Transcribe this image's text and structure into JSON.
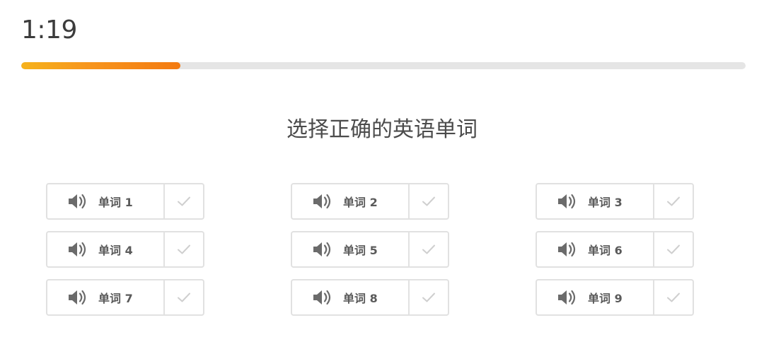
{
  "timer": {
    "text": "1:19"
  },
  "progress": {
    "fraction": 0.22
  },
  "prompt": {
    "text": "选择正确的英语单词"
  },
  "icons": {
    "speaker": "speaker-icon",
    "check": "check-icon"
  },
  "colors": {
    "progress_start": "#f6b21c",
    "progress_end": "#f37a10",
    "track": "#e5e5e5",
    "border": "#e1e1e1",
    "icon": "#6b6b6b",
    "check": "#cfcfcf"
  },
  "words": [
    {
      "label": "单词 1"
    },
    {
      "label": "单词 2"
    },
    {
      "label": "单词 3"
    },
    {
      "label": "单词 4"
    },
    {
      "label": "单词 5"
    },
    {
      "label": "单词 6"
    },
    {
      "label": "单词 7"
    },
    {
      "label": "单词 8"
    },
    {
      "label": "单词 9"
    }
  ]
}
